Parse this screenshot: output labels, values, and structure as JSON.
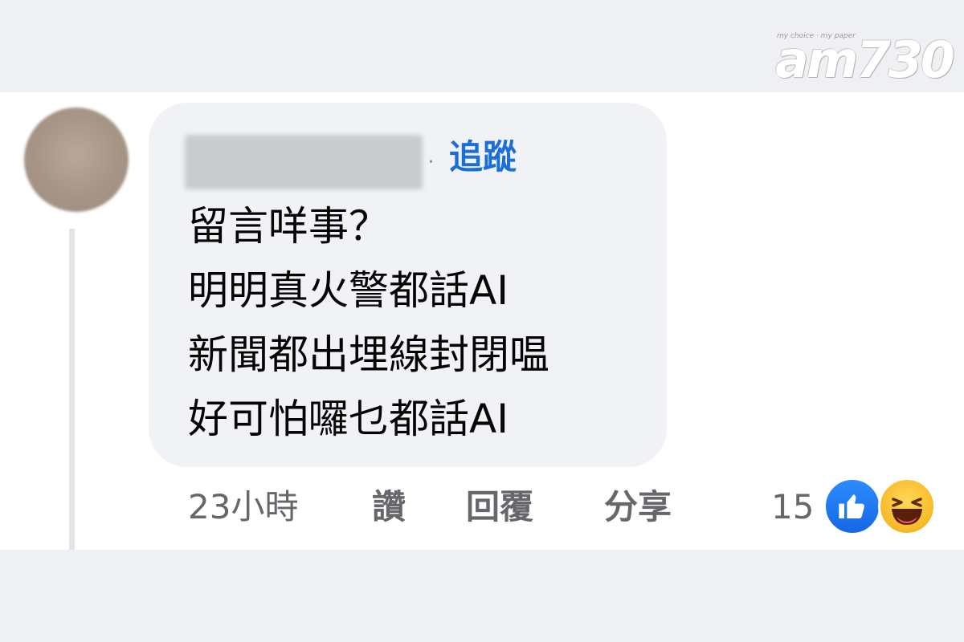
{
  "watermark": {
    "tagline": "my choice · my paper",
    "word": "am730"
  },
  "comment": {
    "follow_label": "追蹤",
    "lines": [
      "留言咩事？",
      "明明真火警都話AI",
      "新聞都出埋線封閉嗢",
      "好可怕囉乜都話AI"
    ]
  },
  "actions": {
    "time": "23小時",
    "like": "讚",
    "reply": "回覆",
    "share": "分享"
  },
  "reactions": {
    "count": "15",
    "icons": [
      "like-icon",
      "haha-icon"
    ],
    "colors": {
      "like": "#1877f2",
      "haha": "#f7b928",
      "follow": "#1a6ed8"
    }
  }
}
